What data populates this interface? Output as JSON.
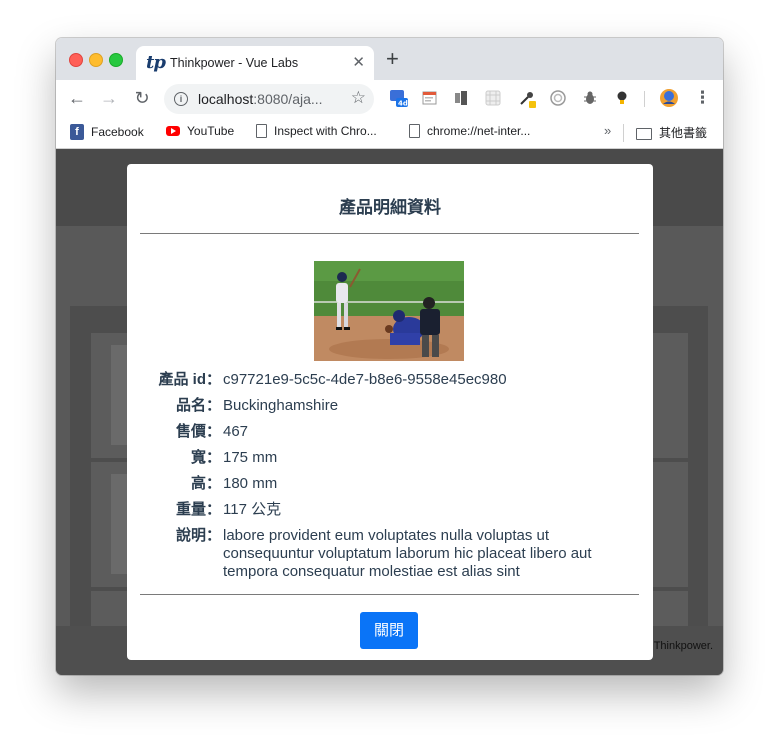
{
  "browser": {
    "tab_title": "Thinkpower - Vue Labs",
    "tab_favicon_text": "tp",
    "url_host": "localhost",
    "url_rest": ":8080/aja...",
    "bookmarks": [
      {
        "label": "Facebook",
        "icon": "facebook-icon"
      },
      {
        "label": "YouTube",
        "icon": "youtube-icon"
      },
      {
        "label": "Inspect with Chro...",
        "icon": "page-icon"
      },
      {
        "label": "chrome://net-inter...",
        "icon": "page-icon"
      }
    ],
    "other_bookmarks": "其他書籤",
    "more_bookmarks": "»",
    "extension_badge": "4d"
  },
  "page": {
    "footer_text": "Thinkpower."
  },
  "modal": {
    "title": "產品明細資料",
    "image_description": "baseball batter, catcher and umpire at home plate",
    "fields": [
      {
        "label": "產品 id：",
        "value": "c97721e9-5c5c-4de7-b8e6-9558e45ec980"
      },
      {
        "label": "品名：",
        "value": "Buckinghamshire"
      },
      {
        "label": "售價：",
        "value": "467"
      },
      {
        "label": "寬：",
        "value": "175 mm"
      },
      {
        "label": "高：",
        "value": "180 mm"
      },
      {
        "label": "重量：",
        "value": "117 公克"
      },
      {
        "label": "說明：",
        "value": "labore provident eum voluptates nulla voluptas ut consequuntur voluptatum laborum hic placeat libero aut tempora consequatur molestiae est alias sint"
      }
    ],
    "close_label": "關閉"
  },
  "colors": {
    "primary_button": "#0a74f7",
    "title_text": "#2c3e50",
    "overlay": "#595959"
  }
}
